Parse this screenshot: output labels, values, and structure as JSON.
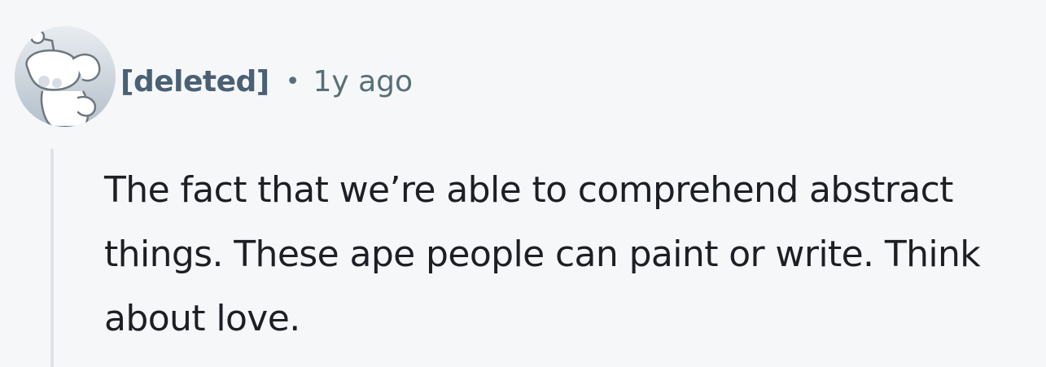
{
  "comment": {
    "author": "[deleted]",
    "separator": "•",
    "timestamp": "1y ago",
    "body": "The fact that we’re able to comprehend abstract things. These ape people can paint or write. Think about love.",
    "avatar_icon": "reddit-snoo-deleted-icon"
  },
  "colors": {
    "background": "#f6f7f9",
    "author": "#4a6075",
    "meta": "#576f76",
    "body": "#1c1f24",
    "thread_line": "#dfe3e8"
  }
}
